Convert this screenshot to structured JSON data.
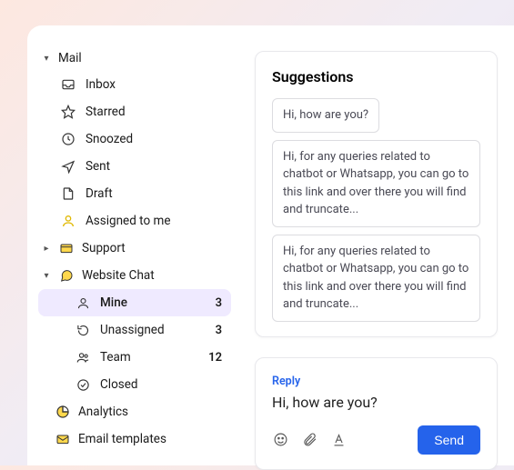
{
  "sidebar": {
    "mail": {
      "label": "Mail",
      "items": [
        {
          "label": "Inbox"
        },
        {
          "label": "Starred"
        },
        {
          "label": "Snoozed"
        },
        {
          "label": "Sent"
        },
        {
          "label": "Draft"
        },
        {
          "label": "Assigned to me"
        }
      ]
    },
    "support": {
      "label": "Support"
    },
    "website_chat": {
      "label": "Website Chat",
      "items": [
        {
          "label": "Mine",
          "count": "3"
        },
        {
          "label": "Unassigned",
          "count": "3"
        },
        {
          "label": "Team",
          "count": "12"
        },
        {
          "label": "Closed"
        }
      ]
    },
    "analytics": {
      "label": "Analytics"
    },
    "email_templates": {
      "label": "Email templates"
    }
  },
  "suggestions": {
    "title": "Suggestions",
    "items": [
      "Hi, how are you?",
      "Hi, for any queries related to chatbot or Whatsapp, you can go to this link and over there you will find and truncate...",
      "Hi, for any queries related to chatbot or Whatsapp, you can go to this link and over there you will find and truncate..."
    ]
  },
  "reply": {
    "label": "Reply",
    "text": "Hi, how are you?",
    "send": "Send"
  }
}
